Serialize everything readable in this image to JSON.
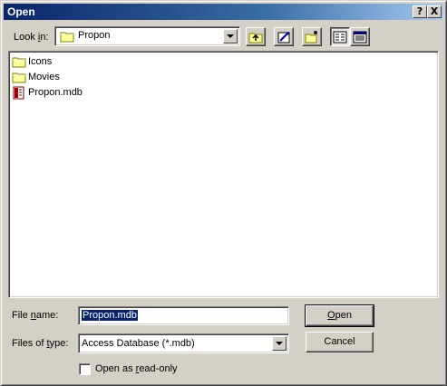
{
  "window": {
    "title": "Open",
    "help_btn": "?",
    "close_btn": "X"
  },
  "toolbar": {
    "look_in_label_pre": "Look ",
    "look_in_label_u": "i",
    "look_in_label_post": "n:",
    "look_in_value": "Propon",
    "buttons": [
      {
        "icon": "up-one-level-icon"
      },
      {
        "icon": "favorites-icon"
      },
      {
        "icon": "new-folder-icon"
      },
      {
        "icon": "list-view-icon"
      },
      {
        "icon": "details-view-icon"
      }
    ]
  },
  "files": [
    {
      "name": "Icons",
      "icon": "folder-icon"
    },
    {
      "name": "Movies",
      "icon": "folder-icon"
    },
    {
      "name": "Propon.mdb",
      "icon": "access-database-icon"
    }
  ],
  "filename": {
    "label_pre": "File ",
    "label_u": "n",
    "label_post": "ame:",
    "value": "Propon.mdb"
  },
  "filetype": {
    "label_pre": "Files of ",
    "label_u": "t",
    "label_post": "ype:",
    "value": "Access Database (*.mdb)"
  },
  "buttons": {
    "open_u": "O",
    "open_rest": "pen",
    "cancel": "Cancel"
  },
  "readonly": {
    "label_pre": "Open as ",
    "label_u": "r",
    "label_post": "ead-only",
    "checked": false
  }
}
